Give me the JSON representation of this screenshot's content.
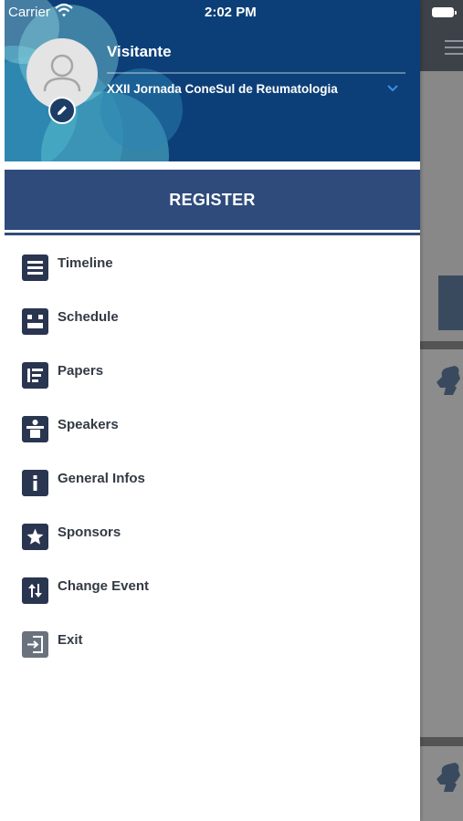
{
  "status_bar": {
    "carrier": "Carrier",
    "time": "2:02 PM"
  },
  "profile": {
    "name": "Visitante",
    "event": "XXII Jornada ConeSul de Reumatologia"
  },
  "register": {
    "label": "REGISTER"
  },
  "menu": {
    "items": [
      {
        "label": "Timeline",
        "icon": "timeline-icon"
      },
      {
        "label": "Schedule",
        "icon": "schedule-icon"
      },
      {
        "label": "Papers",
        "icon": "papers-icon"
      },
      {
        "label": "Speakers",
        "icon": "speakers-icon"
      },
      {
        "label": "General Infos",
        "icon": "info-icon"
      },
      {
        "label": "Sponsors",
        "icon": "star-icon"
      },
      {
        "label": "Change Event",
        "icon": "swap-arrows-icon"
      },
      {
        "label": "Exit",
        "icon": "exit-icon"
      }
    ]
  },
  "colors": {
    "header_bg": "#0c3f78",
    "register_bg": "#2e4b7c",
    "icon_bg": "#2a3550",
    "exit_icon_bg": "#6a737d",
    "menu_text": "#333a44"
  }
}
